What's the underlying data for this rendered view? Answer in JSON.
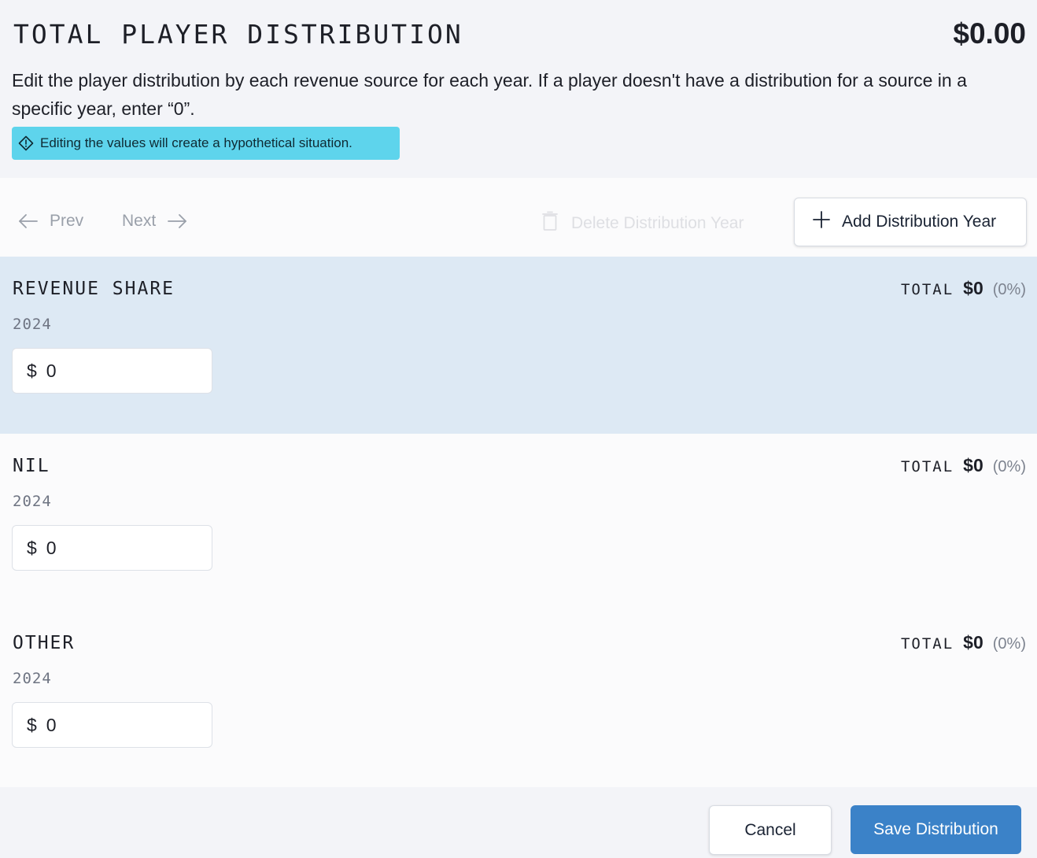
{
  "header": {
    "title": "TOTAL PLAYER DISTRIBUTION",
    "total": "$0.00",
    "description": "Edit the player distribution by each revenue source for each year. If a player doesn't have a distribution for a source in a specific year, enter “0”.",
    "warning": "Editing the values will create a hypothetical situation.",
    "warning_icon": "alert-diamond-icon",
    "warning_color": "#5ed4ec"
  },
  "toolbar": {
    "prev_label": "Prev",
    "next_label": "Next",
    "delete_label": "Delete Distribution Year",
    "add_label": "Add Distribution Year"
  },
  "sections": [
    {
      "title": "REVENUE SHARE",
      "total_label": "TOTAL",
      "total_value": "$0",
      "total_pct": "(0%)",
      "year": "2024",
      "currency": "$",
      "value": "0"
    },
    {
      "title": "NIL",
      "total_label": "TOTAL",
      "total_value": "$0",
      "total_pct": "(0%)",
      "year": "2024",
      "currency": "$",
      "value": "0"
    },
    {
      "title": "OTHER",
      "total_label": "TOTAL",
      "total_value": "$0",
      "total_pct": "(0%)",
      "year": "2024",
      "currency": "$",
      "value": "0"
    }
  ],
  "footer": {
    "cancel_label": "Cancel",
    "save_label": "Save Distribution",
    "save_color": "#3b82c8"
  }
}
